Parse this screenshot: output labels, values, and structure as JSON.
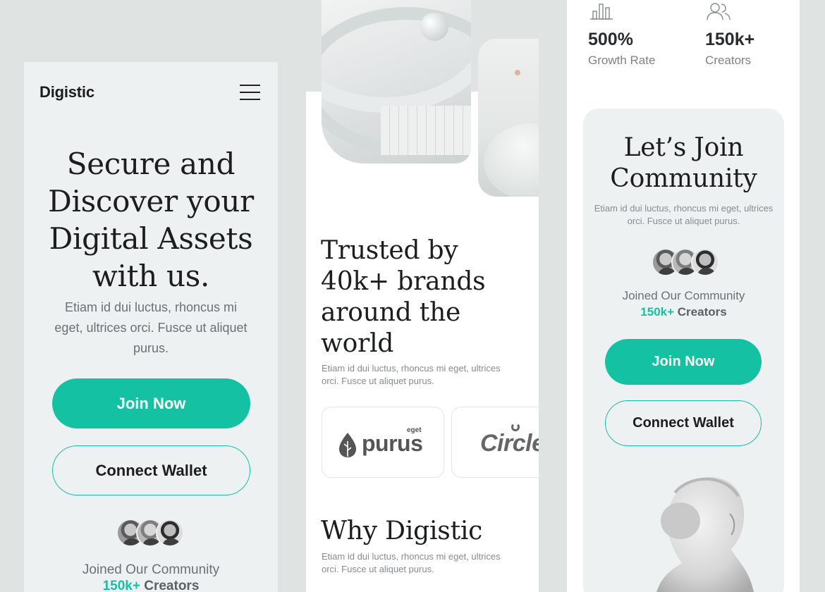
{
  "brand": {
    "name": "Digistic",
    "accent_color": "#14c2a3"
  },
  "panel1": {
    "logo": "Digistic",
    "menu_icon": "hamburger-menu-icon",
    "hero_title_lines": [
      "Secure and",
      "Discover your",
      "Digital Assets",
      "with us."
    ],
    "hero_description": "Etiam id dui luctus, rhoncus mi eget, ultrices orci. Fusce ut aliquet purus.",
    "join_button": "Join Now",
    "wallet_button": "Connect Wallet",
    "joined_text": "Joined Our Community",
    "creators_count": "150k+",
    "creators_label": " Creators"
  },
  "panel2": {
    "trusted_title_lines": [
      "Trusted by",
      "40k+ brands",
      "around the",
      "world"
    ],
    "trusted_description": "Etiam id dui luctus, rhoncus mi eget, ultrices orci. Fusce ut aliquet purus.",
    "brand_logos": [
      {
        "name": "purus",
        "small": "eget",
        "icon": "leaf-icon"
      },
      {
        "name": "Circle"
      }
    ],
    "why_title": "Why Digistic",
    "why_description": "Etiam id dui luctus, rhoncus mi eget, ultrices orci. Fusce ut aliquet purus."
  },
  "panel3": {
    "stats": [
      {
        "value": "500%",
        "label": "Growth Rate",
        "icon": "bar-chart-icon"
      },
      {
        "value": "150k+",
        "label": "Creators",
        "icon": "users-icon"
      }
    ],
    "community_title_lines": [
      "Let’s Join",
      "Community"
    ],
    "community_description": "Etiam id dui luctus, rhoncus mi eget, ultrices orci. Fusce ut aliquet purus.",
    "joined_text": "Joined Our Community",
    "creators_count": "150k+",
    "creators_label": " Creators",
    "join_button": "Join Now",
    "wallet_button": "Connect Wallet"
  }
}
